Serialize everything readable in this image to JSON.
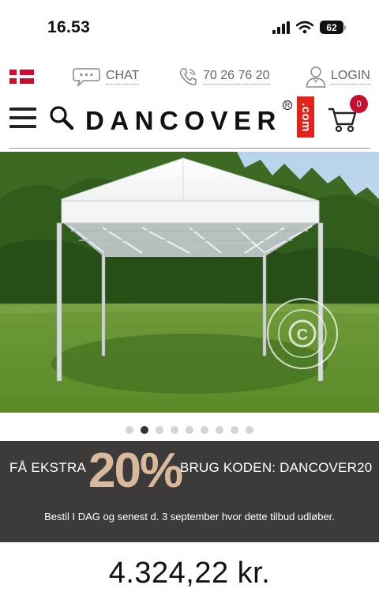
{
  "status_bar": {
    "time": "16.53",
    "battery": "62"
  },
  "utility": {
    "chat_label": "CHAT",
    "phone_label": "70 26 76 20",
    "login_label": "LOGIN",
    "flag": "danish-flag"
  },
  "header": {
    "logo_text": "DANCOVER",
    "logo_reg": "R",
    "logo_com": ".com",
    "cart_count": "0"
  },
  "hero": {
    "watermark_text": "DANCOVER"
  },
  "carousel": {
    "total": 9,
    "active_index": 1
  },
  "promo": {
    "left_text": "FÅ EKSTRA",
    "big_text": "20%",
    "right_text": "BRUG KODEN: DANCOVER20",
    "sub_text": "Bestil I DAG og senest d. 3 september hvor dette tilbud udløber."
  },
  "product": {
    "price": "4.324,22 kr."
  },
  "colors": {
    "accent_red": "#c8102e",
    "promo_bg": "#3c3b3a",
    "promo_highlight": "#d9b99b"
  }
}
